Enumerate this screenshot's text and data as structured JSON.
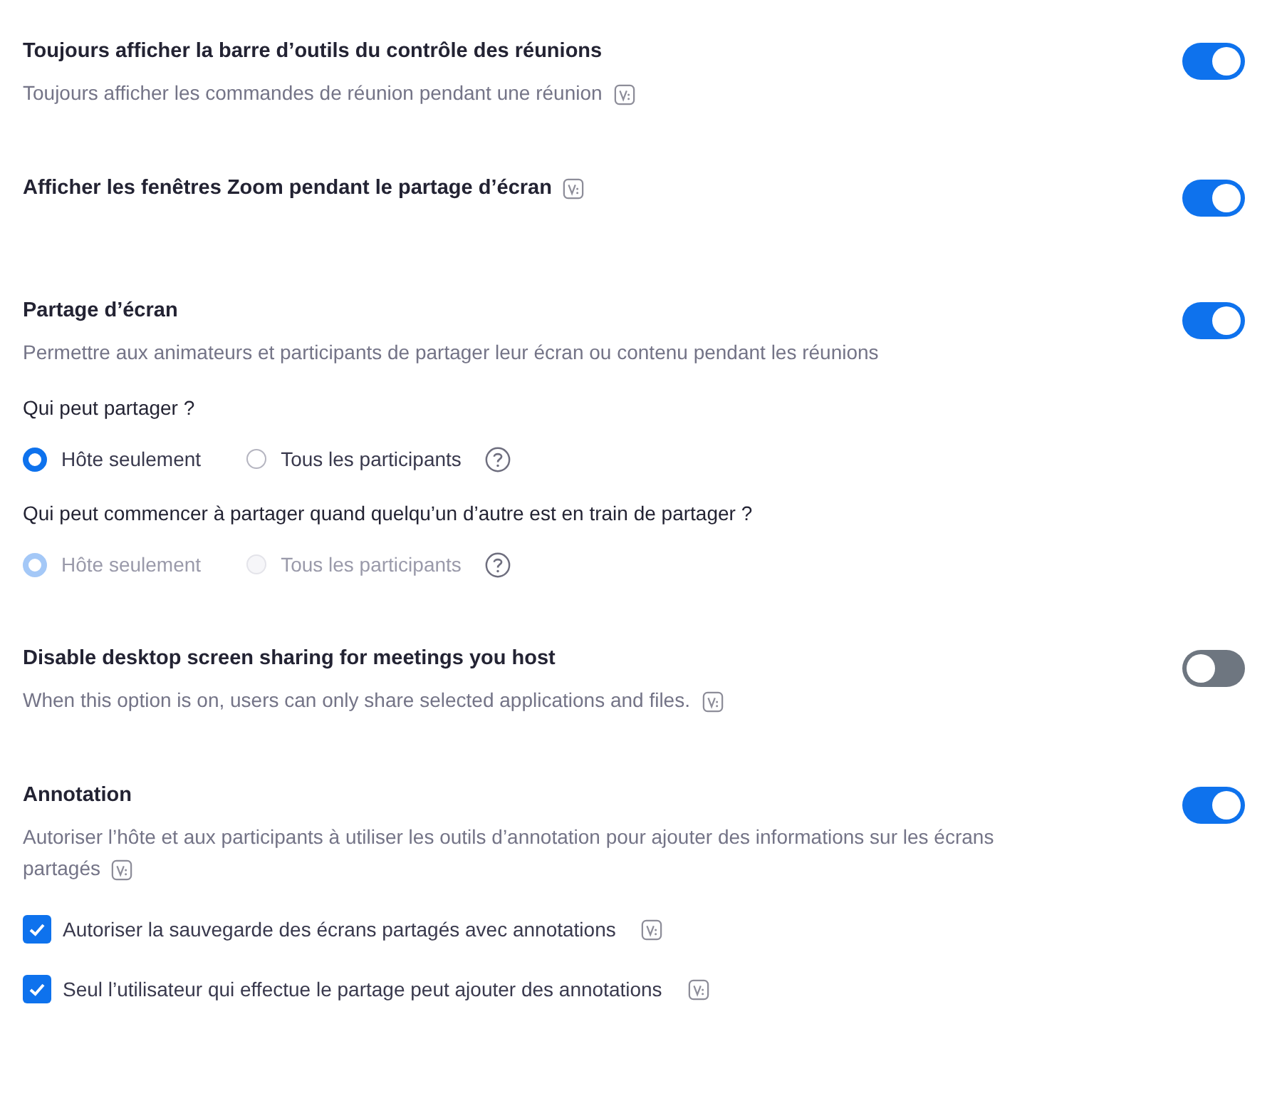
{
  "settings": [
    {
      "title": "Toujours afficher la barre d’outils du contrôle des réunions",
      "description": "Toujours afficher les commandes de réunion pendant une réunion",
      "description_badge": true,
      "on": true
    },
    {
      "title": "Afficher les fenêtres Zoom pendant le partage d’écran",
      "title_badge": true,
      "on": true
    },
    {
      "title": "Partage d’écran",
      "description": "Permettre aux animateurs et participants de partager leur écran ou contenu pendant les réunions",
      "on": true,
      "options": [
        {
          "kind": "radio_group",
          "question": "Qui peut partager ?",
          "disabled": false,
          "help": true,
          "choices": [
            {
              "label": "Hôte seulement",
              "selected": true
            },
            {
              "label": "Tous les participants",
              "selected": false
            }
          ]
        },
        {
          "kind": "radio_group",
          "question": "Qui peut commencer à partager quand quelqu’un d’autre est en train de partager ?",
          "disabled": true,
          "help": true,
          "choices": [
            {
              "label": "Hôte seulement",
              "selected": true
            },
            {
              "label": "Tous les participants",
              "selected": false
            }
          ]
        }
      ]
    },
    {
      "title": "Disable desktop screen sharing for meetings you host",
      "description": "When this option is on, users can only share selected applications and files.",
      "description_badge": true,
      "on": false
    },
    {
      "title": "Annotation",
      "description": "Autoriser l’hôte et aux participants à utiliser les outils d’annotation pour ajouter des informations sur les écrans partagés",
      "description_badge": true,
      "on": true,
      "options": [
        {
          "kind": "checkbox",
          "label": "Autoriser la sauvegarde des écrans partagés avec annotations",
          "checked": true,
          "badge": true
        },
        {
          "kind": "checkbox",
          "label": "Seul l’utilisateur qui effectue le partage peut ajouter des annotations",
          "checked": true,
          "badge": true
        }
      ]
    }
  ]
}
